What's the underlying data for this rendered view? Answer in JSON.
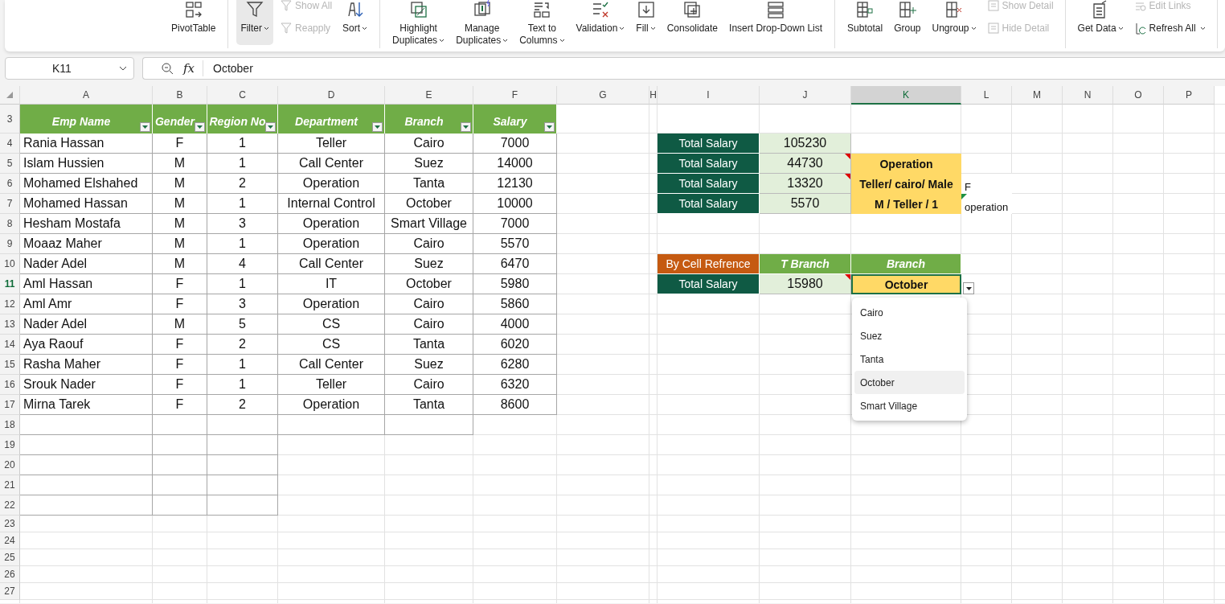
{
  "ribbon": {
    "groups": [
      {
        "items": [
          {
            "kind": "large",
            "label_lines": [
              "PivotTable"
            ],
            "dropdown": false,
            "selected": false,
            "disabled": false
          }
        ]
      },
      {
        "items": [
          {
            "kind": "large",
            "label_lines": [
              "Filter"
            ],
            "dropdown": true,
            "selected": true,
            "disabled": false
          },
          {
            "kind": "stack",
            "buttons": [
              {
                "label": "Show All",
                "disabled": true,
                "dropdown": false
              },
              {
                "label": "Reapply",
                "disabled": true,
                "dropdown": false
              }
            ]
          },
          {
            "kind": "large",
            "label_lines": [
              "Sort"
            ],
            "dropdown": true,
            "selected": false,
            "disabled": false
          }
        ]
      },
      {
        "items": [
          {
            "kind": "large",
            "label_lines": [
              "Highlight",
              "Duplicates"
            ],
            "dropdown": true,
            "selected": false,
            "disabled": false
          },
          {
            "kind": "large",
            "label_lines": [
              "Manage",
              "Duplicates"
            ],
            "dropdown": true,
            "selected": false,
            "disabled": false
          },
          {
            "kind": "large",
            "label_lines": [
              "Text to",
              "Columns"
            ],
            "dropdown": true,
            "selected": false,
            "disabled": false
          },
          {
            "kind": "large",
            "label_lines": [
              "Validation"
            ],
            "dropdown": true,
            "selected": false,
            "disabled": false
          },
          {
            "kind": "large",
            "label_lines": [
              "Fill"
            ],
            "dropdown": true,
            "selected": false,
            "disabled": false
          },
          {
            "kind": "large",
            "label_lines": [
              "Consolidate"
            ],
            "dropdown": false,
            "selected": false,
            "disabled": false
          },
          {
            "kind": "large",
            "label_lines": [
              "Insert Drop-Down List"
            ],
            "dropdown": false,
            "selected": false,
            "disabled": false
          }
        ]
      },
      {
        "items": [
          {
            "kind": "large",
            "label_lines": [
              "Subtotal"
            ],
            "dropdown": false,
            "selected": false,
            "disabled": false
          },
          {
            "kind": "large",
            "label_lines": [
              "Group"
            ],
            "dropdown": false,
            "selected": false,
            "disabled": false
          },
          {
            "kind": "large",
            "label_lines": [
              "Ungroup"
            ],
            "dropdown": true,
            "selected": false,
            "disabled": false
          },
          {
            "kind": "stack",
            "buttons": [
              {
                "label": "Show Detail",
                "disabled": true,
                "dropdown": false
              },
              {
                "label": "Hide Detail",
                "disabled": true,
                "dropdown": false
              }
            ]
          }
        ]
      },
      {
        "items": [
          {
            "kind": "large",
            "label_lines": [
              "Get Data"
            ],
            "dropdown": true,
            "selected": false,
            "disabled": false
          },
          {
            "kind": "stack",
            "buttons": [
              {
                "label": "Edit Links",
                "disabled": true,
                "dropdown": false
              },
              {
                "label": "Refresh All",
                "disabled": false,
                "dropdown": true
              }
            ]
          }
        ]
      }
    ]
  },
  "formula_bar": {
    "name_box": "K11",
    "function_label": "fx",
    "content": "October"
  },
  "sheet": {
    "column_headers": [
      "A",
      "B",
      "C",
      "D",
      "E",
      "F",
      "G",
      "H",
      "I",
      "J",
      "K",
      "L",
      "M",
      "N",
      "O",
      "P"
    ],
    "row_numbers": [
      "3",
      "4",
      "5",
      "6",
      "7",
      "8",
      "9",
      "10",
      "11",
      "12",
      "13",
      "14",
      "15",
      "16",
      "17",
      "18",
      "19",
      "20",
      "21",
      "22",
      "23",
      "24",
      "25",
      "26",
      "27"
    ],
    "employees": {
      "columns": [
        "Emp Name",
        "Gender",
        "Region No",
        "Department",
        "Branch",
        "Salary"
      ],
      "rows": [
        [
          "Rania Hassan",
          "F",
          "1",
          "Teller",
          "Cairo",
          "7000"
        ],
        [
          "Islam Hussien",
          "M",
          "1",
          "Call Center",
          "Suez",
          "14000"
        ],
        [
          "Mohamed Elshahed",
          "M",
          "2",
          "Operation",
          "Tanta",
          "12130"
        ],
        [
          "Mohamed Hassan",
          "M",
          "1",
          "Internal Control",
          "October",
          "10000"
        ],
        [
          "Hesham Mostafa",
          "M",
          "3",
          "Operation",
          "Smart Village",
          "7000"
        ],
        [
          "Moaaz Maher",
          "M",
          "1",
          "Operation",
          "Cairo",
          "5570"
        ],
        [
          "Nader Adel",
          "M",
          "4",
          "Call Center",
          "Suez",
          "6470"
        ],
        [
          "Aml Hassan",
          "F",
          "1",
          "IT",
          "October",
          "5980"
        ],
        [
          "Aml Amr",
          "F",
          "3",
          "Operation",
          "Cairo",
          "5860"
        ],
        [
          "Nader Adel",
          "M",
          "5",
          "CS",
          "Cairo",
          "4000"
        ],
        [
          "Aya Raouf",
          "F",
          "2",
          "CS",
          "Tanta",
          "6020"
        ],
        [
          "Rasha Maher",
          "F",
          "1",
          "Call Center",
          "Suez",
          "6280"
        ],
        [
          "Srouk Nader",
          "F",
          "1",
          "Teller",
          "Cairo",
          "6320"
        ],
        [
          "Mirna Tarek",
          "F",
          "2",
          "Operation",
          "Tanta",
          "8600"
        ]
      ]
    },
    "totals": [
      {
        "label": "Total Salary",
        "value": "105230",
        "comment": false
      },
      {
        "label": "Total Salary",
        "value": "44730",
        "comment": true
      },
      {
        "label": "Total Salary",
        "value": "13320",
        "comment": true
      },
      {
        "label": "Total Salary",
        "value": "5570",
        "comment": false
      }
    ],
    "criteria": [
      "Operation",
      "Teller/ cairo/ Male",
      "M / Teller / 1"
    ],
    "notes": [
      {
        "text": "F",
        "error_flag": false
      },
      {
        "text": "operation",
        "error_flag": true
      }
    ],
    "lookup": {
      "title": "By Cell Refrence",
      "headers": [
        "T Branch",
        "Branch"
      ],
      "label": "Total Salary",
      "value": "15980",
      "comment": true,
      "choice": "October"
    },
    "validation_list": {
      "items": [
        {
          "label": "Cairo",
          "selected": false
        },
        {
          "label": "Suez",
          "selected": false
        },
        {
          "label": "Tanta",
          "selected": false
        },
        {
          "label": "October",
          "selected": true
        },
        {
          "label": "Smart Village",
          "selected": false
        }
      ]
    }
  }
}
